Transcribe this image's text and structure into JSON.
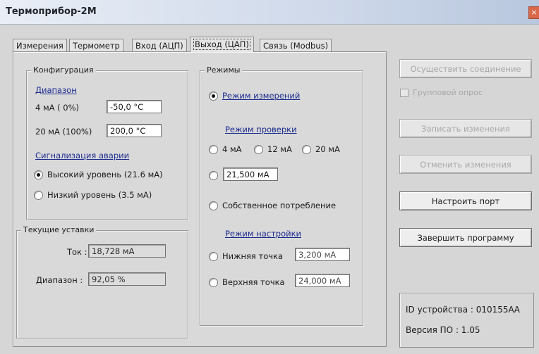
{
  "window": {
    "title": "Термоприбор-2М"
  },
  "tabs": [
    {
      "label": "Измерения"
    },
    {
      "label": "Термометр"
    },
    {
      "label": "Вход (АЦП)"
    },
    {
      "label": "Выход (ЦАП)"
    },
    {
      "label": "Связь (Modbus)"
    }
  ],
  "config": {
    "title": "Конфигурация",
    "range_link": "Диапазон",
    "low_label": "4 мА ( 0%)",
    "low_value": "-50,0 °C",
    "high_label": "20 мА (100%)",
    "high_value": "200,0 °C",
    "alarm_link": "Сигнализация аварии",
    "alarm_high": "Высокий уровень (21.6 мА)",
    "alarm_low": "Низкий уровень (3.5 мА)"
  },
  "current": {
    "title": "Текущие уставки",
    "current_label": "Ток :",
    "current_value": "18,728 мА",
    "range_label": "Диапазон :",
    "range_value": "92,05 %"
  },
  "modes": {
    "title": "Режимы",
    "measure_mode": "Режим измерений",
    "check_link": "Режим  проверки",
    "opt_4ma": "4 мА",
    "opt_12ma": "12 мА",
    "opt_20ma": "20 мА",
    "custom_value": "21,500  мА",
    "self_consumption": "Собственное потребление",
    "setup_link": "Режим  настройки",
    "low_point": "Нижняя точка",
    "low_point_value": "3,200  мА",
    "high_point": "Верхняя точка",
    "high_point_value": "24,000  мА"
  },
  "sidebar": {
    "connect": "Осуществить соединение",
    "group_poll": "Групповой опрос",
    "write": "Записать изменения",
    "cancel": "Отменить изменения",
    "port": "Настроить порт",
    "exit": "Завершить программу",
    "device_id": "ID устройства :  010155АА",
    "fw_version": "Версия ПО :  1.05"
  }
}
